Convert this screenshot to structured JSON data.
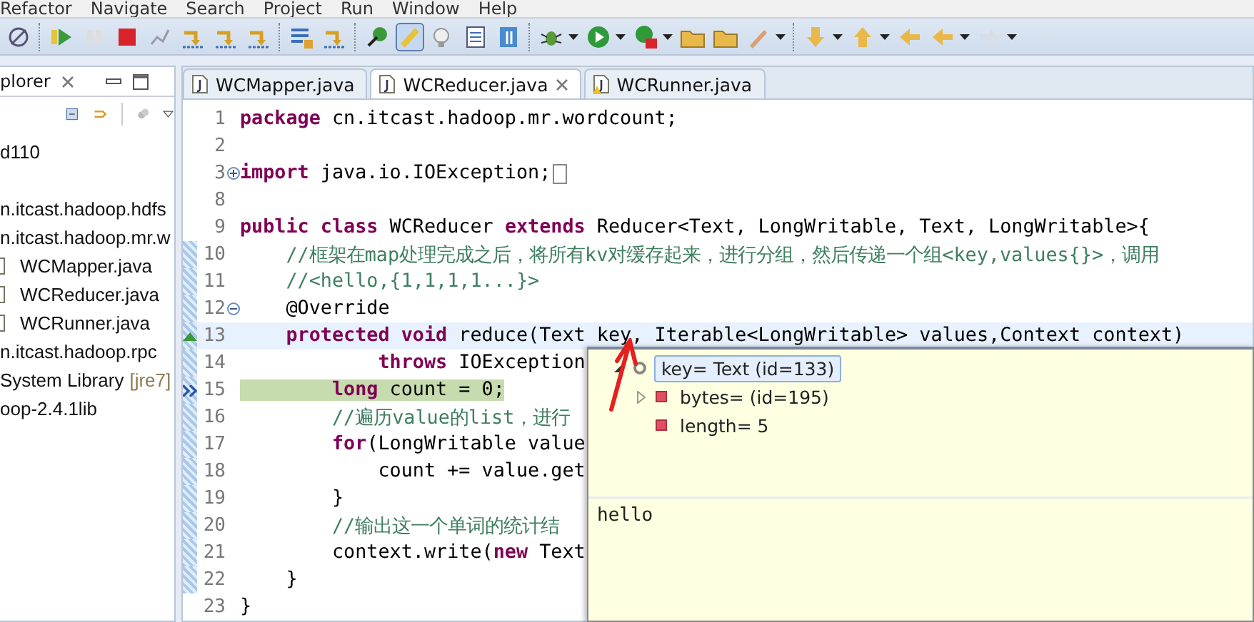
{
  "menu": [
    "Refactor",
    "Navigate",
    "Search",
    "Project",
    "Run",
    "Window",
    "Help"
  ],
  "explorer": {
    "title": "plorer",
    "items": [
      {
        "label": "d110"
      },
      {
        "label": "n.itcast.hadoop.hdfs"
      },
      {
        "label": "n.itcast.hadoop.mr.w",
        "children": [
          {
            "label": "WCMapper.java"
          },
          {
            "label": "WCReducer.java"
          },
          {
            "label": "WCRunner.java"
          }
        ]
      },
      {
        "label": "n.itcast.hadoop.rpc"
      },
      {
        "label": "System Library",
        "decoration": "[jre7]"
      },
      {
        "label": "oop-2.4.1lib"
      }
    ]
  },
  "tabs": [
    {
      "label": "WCMapper.java",
      "selected": false,
      "warning": false
    },
    {
      "label": "WCReducer.java",
      "selected": true,
      "warning": false
    },
    {
      "label": "WCRunner.java",
      "selected": false,
      "warning": true
    }
  ],
  "lines": [
    {
      "number": "1",
      "kind": "plain",
      "in_range": false,
      "current_line": false,
      "code": "**package** cn.itcast.hadoop.mr.wordcount;"
    },
    {
      "number": "2",
      "kind": "plain",
      "in_range": false,
      "current_line": false
    },
    {
      "number": "3",
      "kind": "folded",
      "in_range": false,
      "current_line": false,
      "code": "**import** java.io.IOException;"
    },
    {
      "number": "8",
      "kind": "plain",
      "in_range": false,
      "current_line": false
    },
    {
      "number": "9",
      "kind": "plain",
      "in_range": false,
      "current_line": false,
      "code": "**public class** WCReducer **extends** Reducer<Text, LongWritable, Text, LongWritable>{"
    },
    {
      "number": "10",
      "kind": "plain",
      "in_range": true,
      "current_line": false,
      "code": "    *//框架在map处理完成之后，将所有kv对缓存起来，进行分组，然后传递一个组<key,values{}>，调用*"
    },
    {
      "number": "11",
      "kind": "plain",
      "in_range": true,
      "current_line": false,
      "code": "    *//<hello,{1,1,1,1...}>*"
    },
    {
      "number": "12",
      "kind": "foldable",
      "in_range": true,
      "current_line": false,
      "code": "    @Override"
    },
    {
      "number": "13",
      "kind": "override",
      "in_range": true,
      "current_line": true,
      "code": "    **protected void** reduce(Text key, Iterable<LongWritable> values,Context context)"
    },
    {
      "number": "14",
      "kind": "plain",
      "in_range": true,
      "current_line": false,
      "code": "            **throws** IOException"
    },
    {
      "number": "15",
      "kind": "pointer",
      "in_range": true,
      "current_line": false,
      "code": "        **long** count = 0;"
    },
    {
      "number": "16",
      "kind": "plain",
      "in_range": true,
      "current_line": false,
      "code": "        *//遍历value的list，进行*"
    },
    {
      "number": "17",
      "kind": "plain",
      "in_range": true,
      "current_line": false,
      "code": "        **for**(LongWritable value"
    },
    {
      "number": "18",
      "kind": "plain",
      "in_range": true,
      "current_line": false,
      "code": "            count += value.get"
    },
    {
      "number": "19",
      "kind": "plain",
      "in_range": true,
      "current_line": false,
      "code": "        }"
    },
    {
      "number": "20",
      "kind": "plain",
      "in_range": true,
      "current_line": false,
      "code": "        *//输出这一个单词的统计结*"
    },
    {
      "number": "21",
      "kind": "plain",
      "in_range": true,
      "current_line": false,
      "code": "        context.write(**new** Text"
    },
    {
      "number": "22",
      "kind": "plain",
      "in_range": true,
      "current_line": false,
      "code": "    }"
    },
    {
      "number": "23",
      "kind": "plain",
      "in_range": false,
      "current_line": false,
      "code": "}"
    }
  ],
  "inspect_popup": {
    "variables": [
      {
        "label": "key= Text  (id=133)",
        "kind": "local",
        "selected": true,
        "expanded": true,
        "children": [
          {
            "label": "bytes= (id=195)",
            "kind": "field",
            "selected": false,
            "expanded": false
          },
          {
            "label": "length= 5",
            "kind": "field",
            "selected": false
          }
        ]
      }
    ],
    "detail": "hello"
  }
}
